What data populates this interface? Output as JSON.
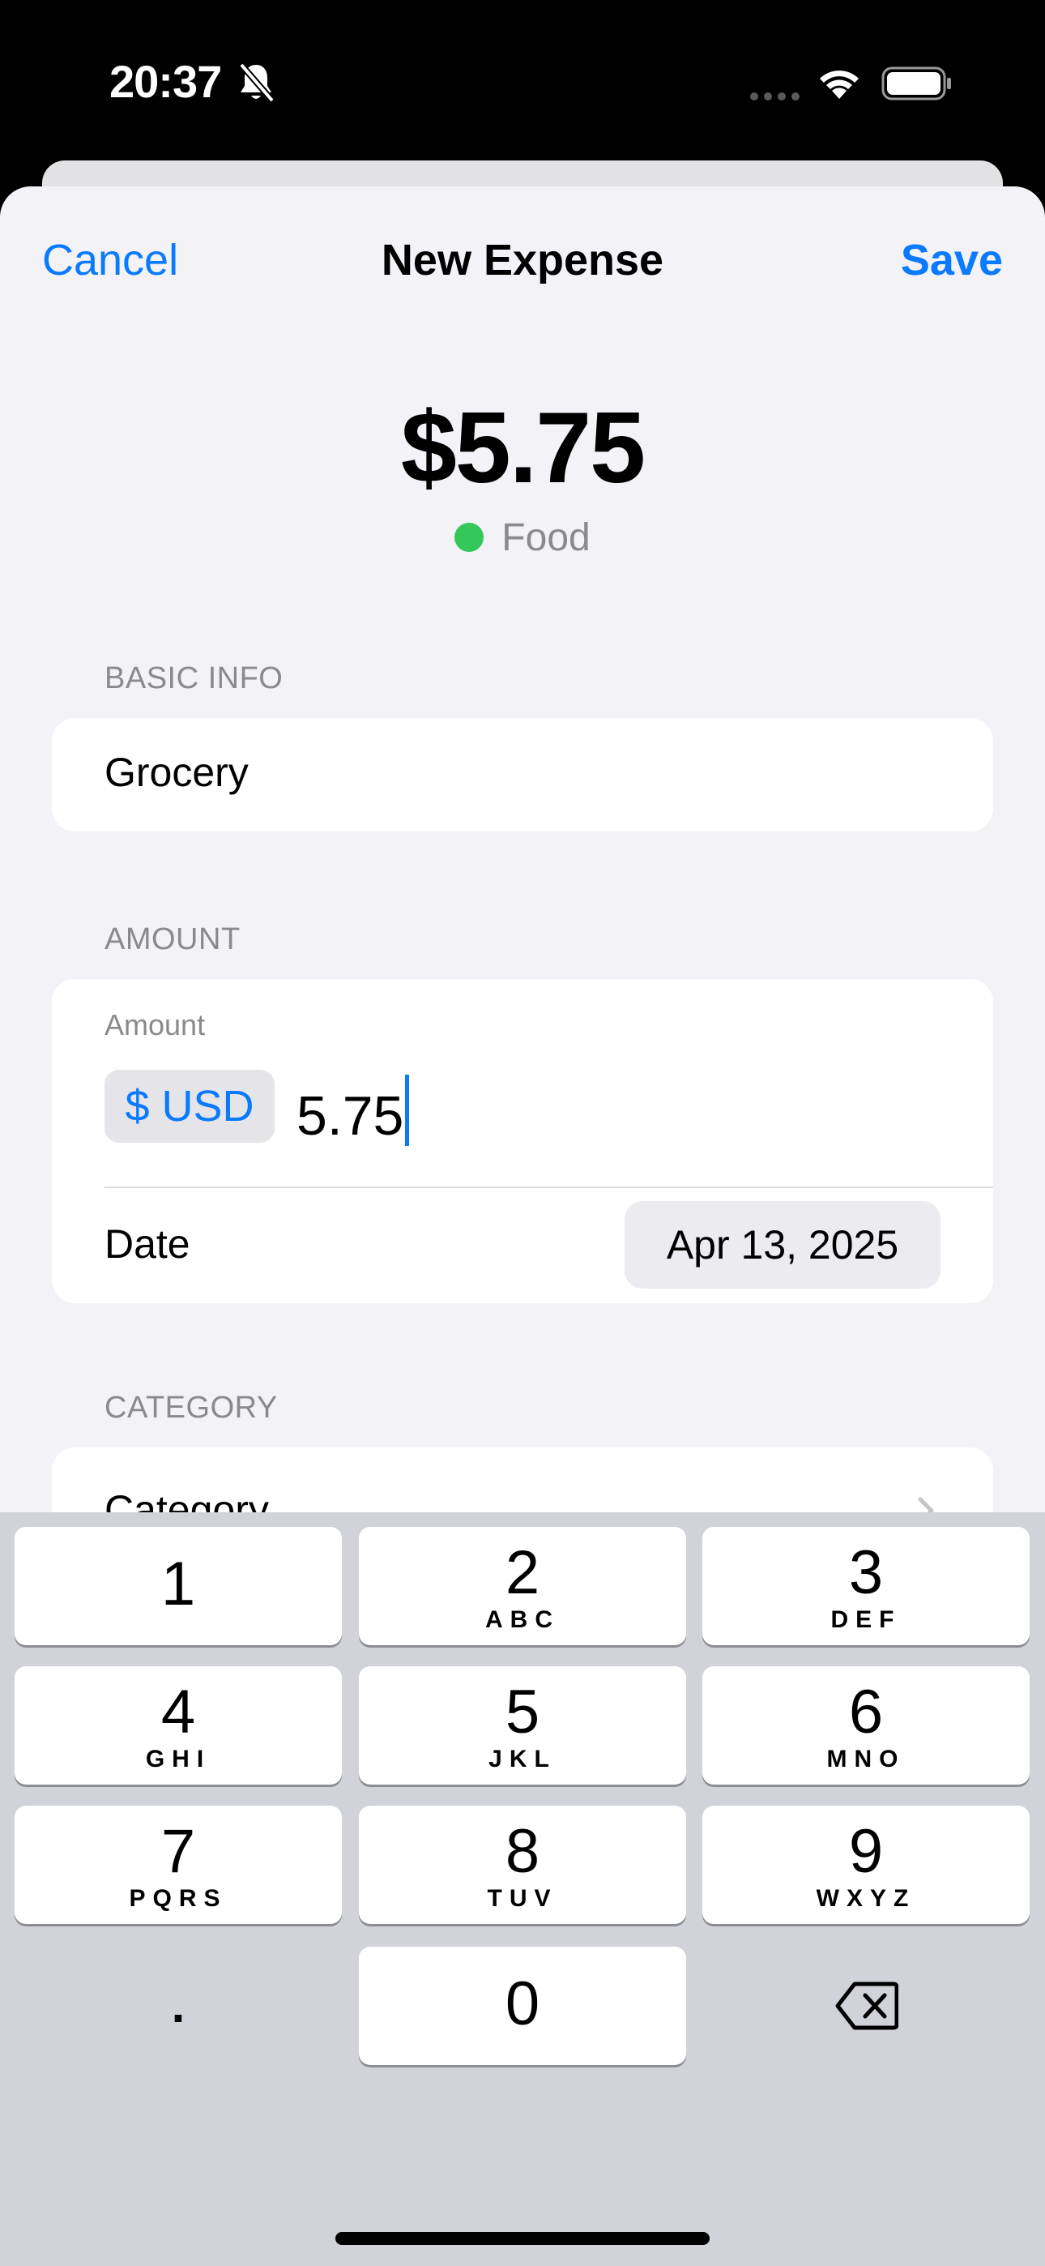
{
  "status_bar": {
    "time": "20:37"
  },
  "nav": {
    "cancel_label": "Cancel",
    "title": "New Expense",
    "save_label": "Save"
  },
  "summary": {
    "amount": "$5.75",
    "category": "Food",
    "category_color": "#34c759"
  },
  "basic_info": {
    "section_label": "BASIC INFO",
    "name_value": "Grocery"
  },
  "amount_section": {
    "section_label": "AMOUNT",
    "field_label": "Amount",
    "currency": "$ USD",
    "value": "5.75",
    "date_label": "Date",
    "date_value": "Apr 13, 2025"
  },
  "category_section": {
    "section_label": "CATEGORY",
    "row_label": "Category"
  },
  "keyboard": {
    "keys": [
      {
        "digit": "1",
        "letters": ""
      },
      {
        "digit": "2",
        "letters": "ABC"
      },
      {
        "digit": "3",
        "letters": "DEF"
      },
      {
        "digit": "4",
        "letters": "GHI"
      },
      {
        "digit": "5",
        "letters": "JKL"
      },
      {
        "digit": "6",
        "letters": "MNO"
      },
      {
        "digit": "7",
        "letters": "PQRS"
      },
      {
        "digit": "8",
        "letters": "TUV"
      },
      {
        "digit": "9",
        "letters": "WXYZ"
      }
    ],
    "decimal_label": ".",
    "zero": "0"
  },
  "colors": {
    "accent": "#0a7aff",
    "background": "#f2f2f7",
    "keyboard": "#d1d3d9"
  }
}
